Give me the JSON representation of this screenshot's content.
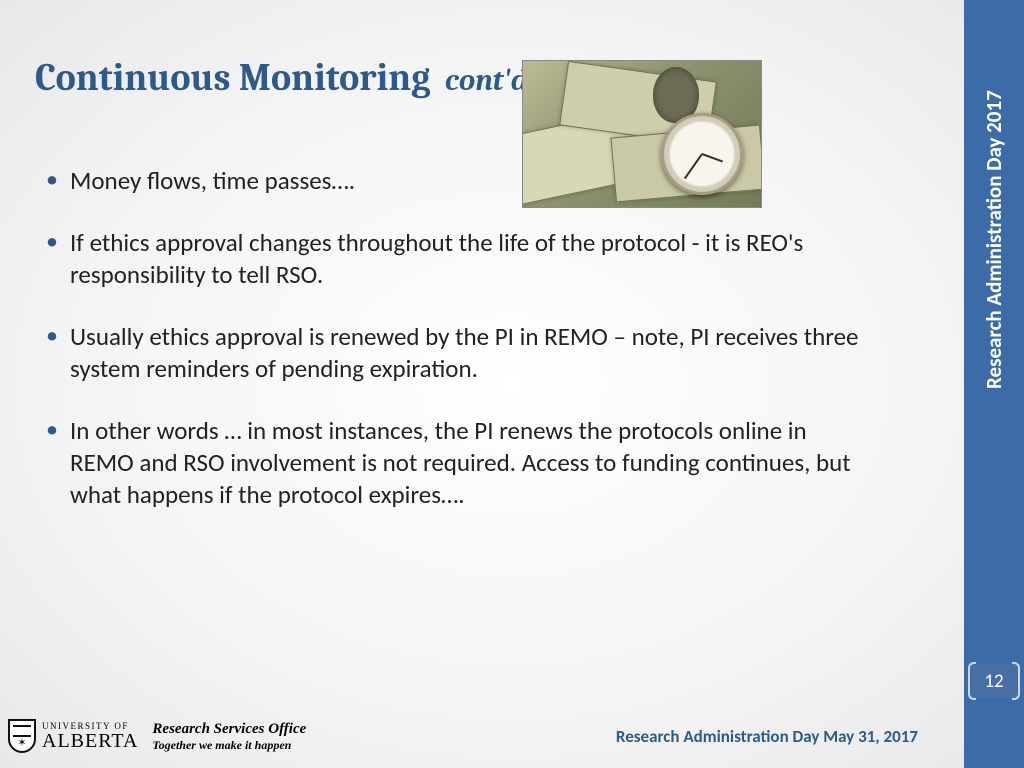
{
  "title": {
    "main": "Continuous Monitoring",
    "suffix": "cont'd"
  },
  "bullets": [
    "Money flows, time passes….",
    "If ethics approval changes throughout the life of the protocol -  it is REO's responsibility to tell RSO.",
    "Usually ethics approval is renewed by the PI in REMO – note, PI receives three system reminders of pending expiration.",
    "In other words … in most instances, the PI renews the protocols online in REMO and RSO involvement is not required. Access to funding continues, but what happens if the protocol expires…."
  ],
  "sidebar": {
    "label": "Research Administration Day 2017",
    "page": "12"
  },
  "footer": {
    "logo_top": "UNIVERSITY OF",
    "logo_bottom": "ALBERTA",
    "office_name": "Research Services Office",
    "office_tagline": "Together we make it happen",
    "right": "Research Administration Day May 31, 2017"
  },
  "image": {
    "alt": "money-and-pocket-watch"
  }
}
